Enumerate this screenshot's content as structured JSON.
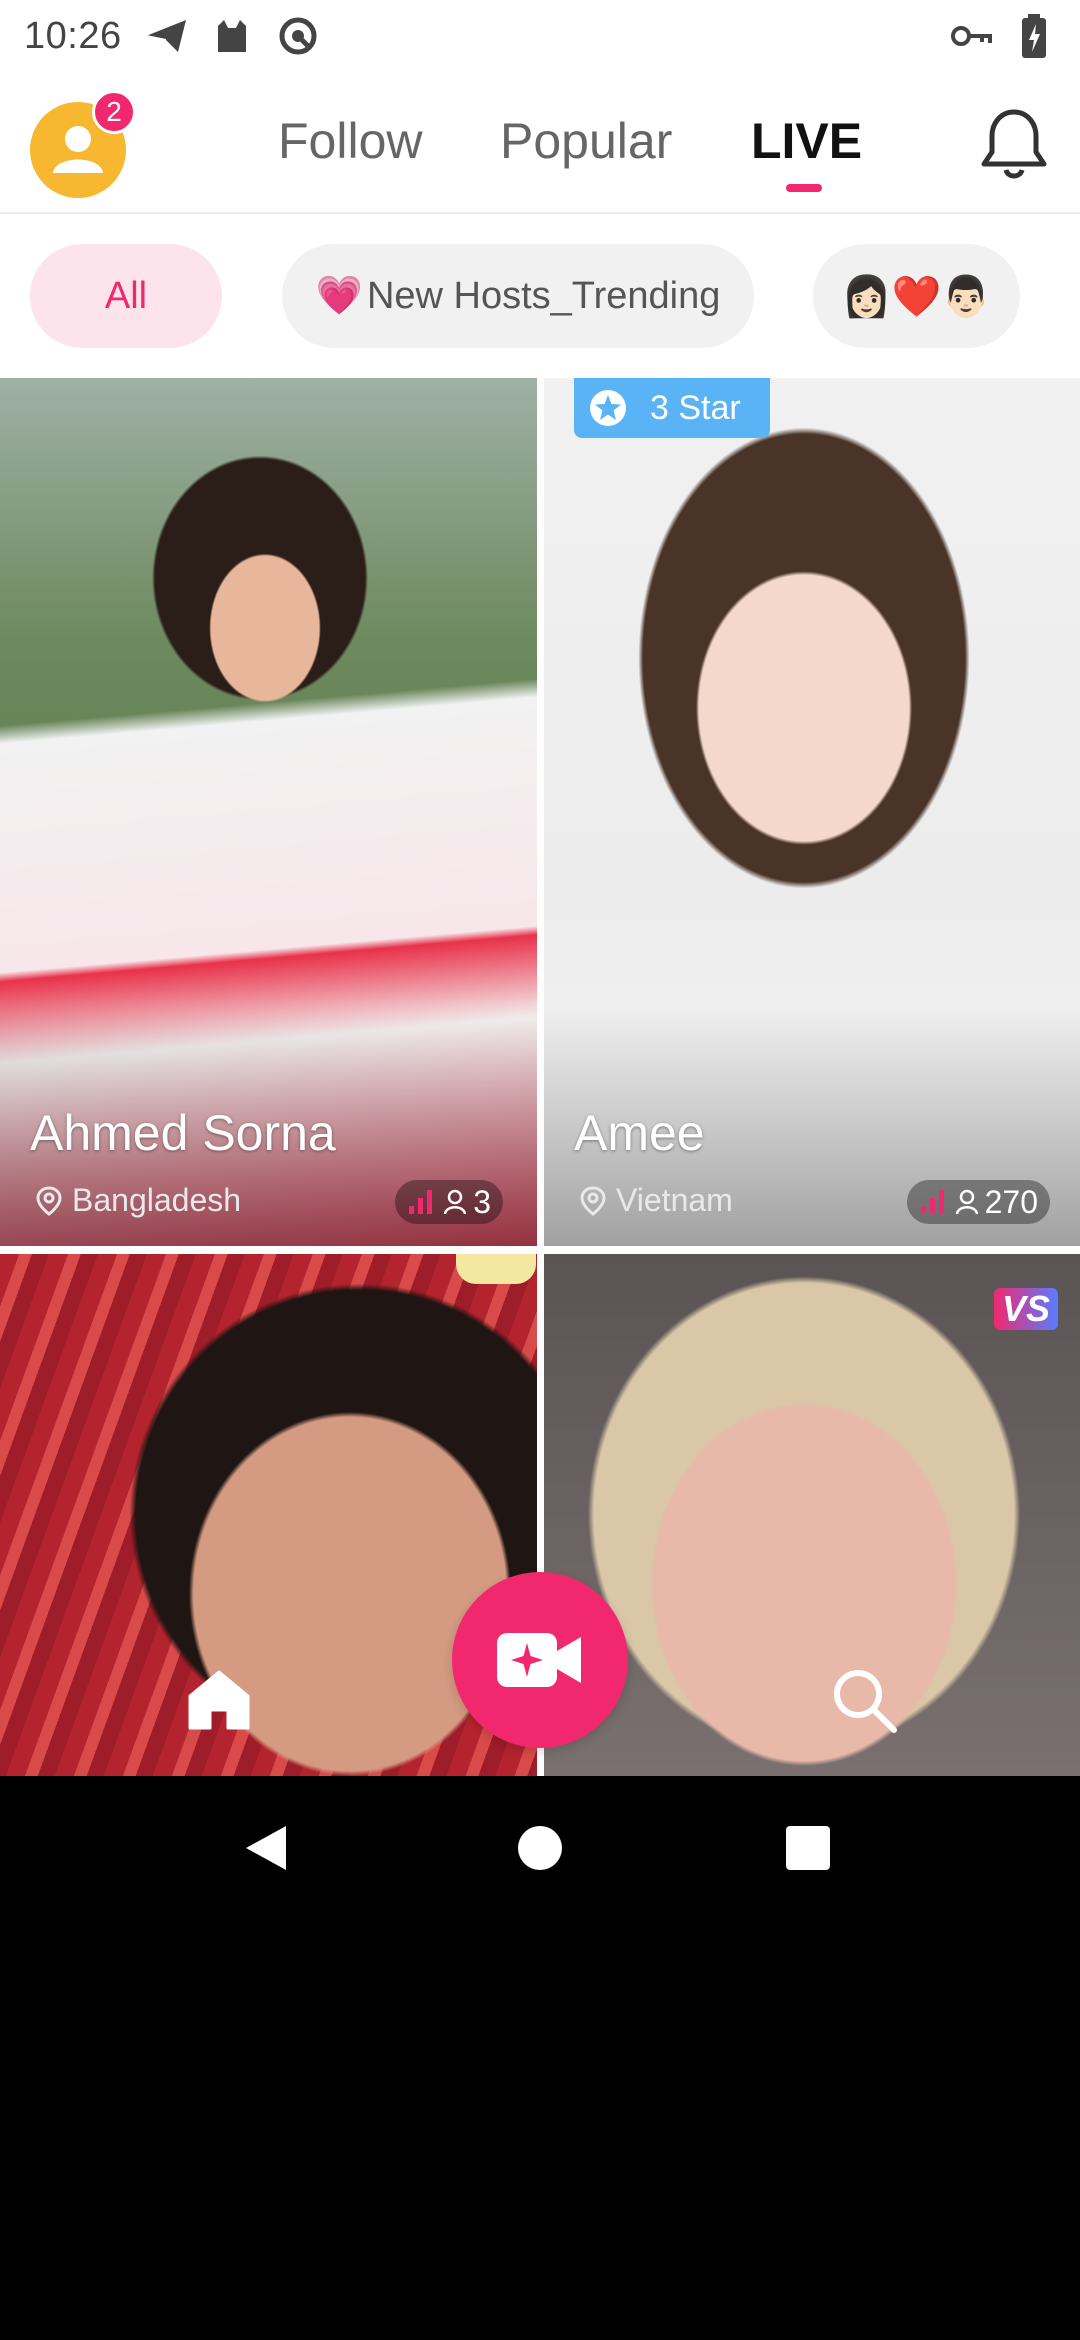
{
  "status_bar": {
    "time": "10:26",
    "left_icons": [
      "send-icon",
      "cat-icon",
      "vpn-icon"
    ],
    "right_icons": [
      "key-icon",
      "battery-charging-icon"
    ]
  },
  "header": {
    "notification_count": "2",
    "tabs": [
      {
        "label": "Follow",
        "active": false
      },
      {
        "label": "Popular",
        "active": false
      },
      {
        "label": "LIVE",
        "active": true
      }
    ],
    "accent_color": "#f2286f"
  },
  "filters": {
    "all": "All",
    "trending_emoji": "💗",
    "trending": "New Hosts_Trending",
    "couple_emoji": "👩🏻❤️👨🏻"
  },
  "cards": [
    {
      "name": "Ahmed Sorna",
      "location": "Bangladesh",
      "viewers": "3",
      "badge": ""
    },
    {
      "name": "Amee",
      "location": "Vietnam",
      "viewers": "270",
      "badge": "3 Star"
    },
    {
      "name": "",
      "location": "",
      "viewers": "",
      "badge": ""
    },
    {
      "name": "",
      "location": "",
      "viewers": "",
      "badge": "VS"
    }
  ],
  "bottom_nav": {
    "items": [
      "home-icon",
      "go-live-icon",
      "search-icon"
    ]
  }
}
